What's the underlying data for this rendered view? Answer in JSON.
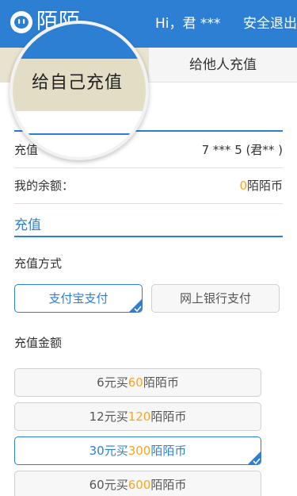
{
  "header": {
    "app_name": "陌陌",
    "greeting": "Hi，君 ***",
    "logout_label": "安全退出",
    "bg_color": "#2d7fd3",
    "logo_icon": "momo-logo-icon"
  },
  "tabs": {
    "self_label": "给自己充值",
    "other_label": "给他人充值"
  },
  "account": {
    "recharge_label": "充值",
    "account_value": "7 *** 5 (君** )",
    "balance_label": "我的余额：",
    "balance_amount": "0",
    "balance_unit": "陌陌币"
  },
  "recharge": {
    "section_title": "充值",
    "method_label": "充值方式",
    "methods": [
      {
        "label": "支付宝支付",
        "selected": true
      },
      {
        "label": "网上银行支付",
        "selected": false
      }
    ],
    "amount_label": "充值金额",
    "amounts": [
      {
        "price": "6元买",
        "coins": "60",
        "unit": "陌陌币",
        "selected": false
      },
      {
        "price": "12元买",
        "coins": "120",
        "unit": "陌陌币",
        "selected": false
      },
      {
        "price": "30元买",
        "coins": "300",
        "unit": "陌陌币",
        "selected": true
      },
      {
        "price": "60元买",
        "coins": "600",
        "unit": "陌陌币",
        "selected": false
      }
    ]
  },
  "colors": {
    "accent": "#2d7fd3",
    "coin_highlight": "#f5a623"
  }
}
